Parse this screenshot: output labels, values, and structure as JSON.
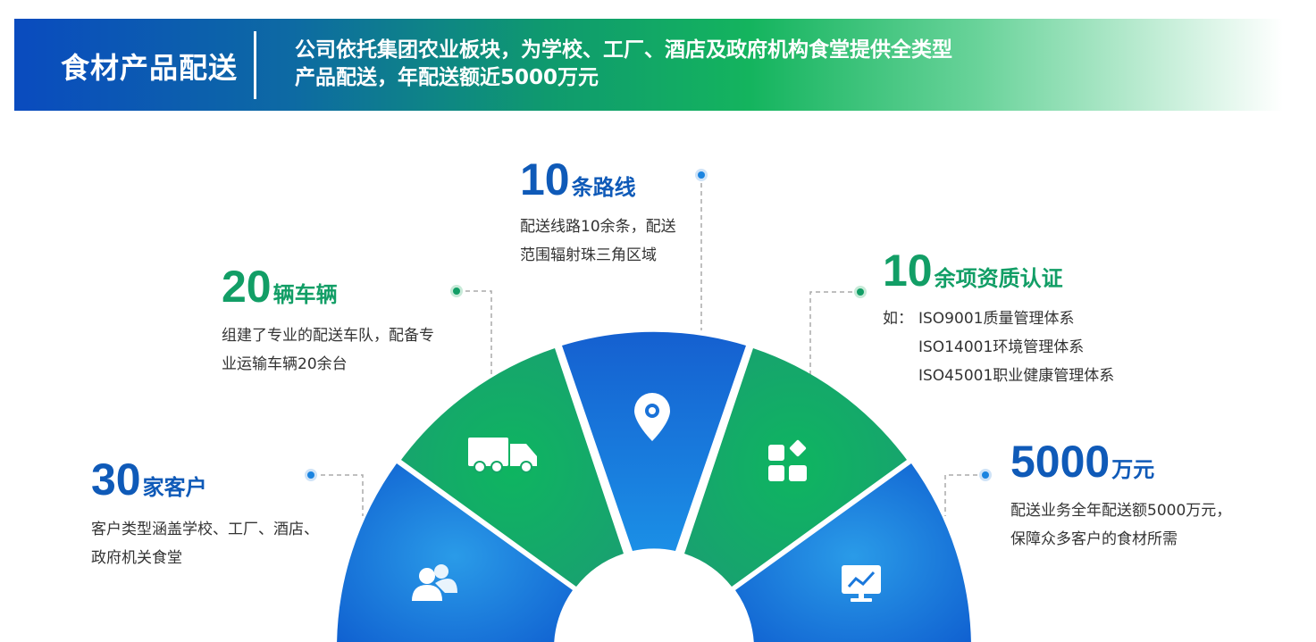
{
  "banner": {
    "title": "食材产品配送",
    "description_line1": "公司依托集团农业板块，为学校、工厂、酒店及政府机构食堂提供全类型",
    "description_line2": "产品配送，年配送额近5000万元"
  },
  "colors": {
    "blue": "#0f5ab8",
    "green": "#129e66",
    "light_blue": "#2f8fe6"
  },
  "stats": [
    {
      "id": "customers",
      "number": "30",
      "unit": "家客户",
      "desc_line1": "客户类型涵盖学校、工厂、酒店、",
      "desc_line2": "政府机关食堂",
      "icon": "users-icon"
    },
    {
      "id": "vehicles",
      "number": "20",
      "unit": "辆车辆",
      "desc_line1": "组建了专业的配送车队，配备专",
      "desc_line2": "业运输车辆20余台",
      "icon": "truck-icon"
    },
    {
      "id": "routes",
      "number": "10",
      "unit": "条路线",
      "desc_line1": "配送线路10余条，配送",
      "desc_line2": "范围辐射珠三角区域",
      "icon": "location-pin-icon"
    },
    {
      "id": "certifications",
      "number": "10",
      "unit": "余项资质认证",
      "prefix": "如：",
      "desc_line1": "ISO9001质量管理体系",
      "desc_line2": "ISO14001环境管理体系",
      "desc_line3": "ISO45001职业健康管理体系",
      "icon": "apps-icon"
    },
    {
      "id": "revenue",
      "number": "5000",
      "unit": "万元",
      "desc_line1": "配送业务全年配送额5000万元，",
      "desc_line2": "保障众多客户的食材所需",
      "icon": "chart-monitor-icon"
    }
  ]
}
